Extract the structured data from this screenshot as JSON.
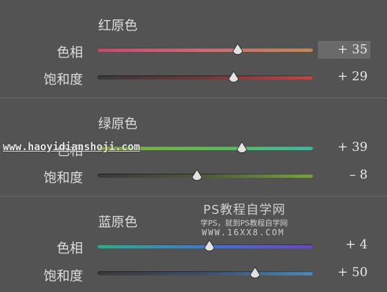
{
  "sections": [
    {
      "title": "红原色",
      "rows": [
        {
          "label": "色相",
          "value": "+ 35",
          "level": 0.65,
          "track": "linear-gradient(90deg,#b8506e,#c4707a 50%,#b98a5e)"
        },
        {
          "label": "饱和度",
          "value": "+ 29",
          "level": 0.63,
          "track": "linear-gradient(90deg,#3a3a3a,#6a3a3a 50%,#b84a4a)"
        }
      ]
    },
    {
      "title": "绿原色",
      "rows": [
        {
          "label": "色相",
          "value": "+ 39",
          "level": 0.67,
          "track": "linear-gradient(90deg,#8ea848,#66b45a 50%,#4ab4a2)"
        },
        {
          "label": "饱和度",
          "value": "– 8",
          "level": 0.46,
          "track": "linear-gradient(90deg,#3a3a3a,#4e5a3e 50%,#7aa048)"
        }
      ]
    },
    {
      "title": "蓝原色",
      "rows": [
        {
          "label": "色相",
          "value": "+ 4",
          "level": 0.52,
          "track": "linear-gradient(90deg,#3aa88a,#4a6fc0 55%,#6a48b4)"
        },
        {
          "label": "饱和度",
          "value": "+ 50",
          "level": 0.73,
          "track": "linear-gradient(90deg,#3a3a3a,#3e4e6a 50%,#4a8ab8)"
        }
      ]
    }
  ],
  "watermark": {
    "url": "www.haoyidianshoji.com",
    "line1": "PS教程自学网",
    "line2": "学PS，就到PS教程自学网",
    "line3": "WWW.16XX8.COM"
  }
}
